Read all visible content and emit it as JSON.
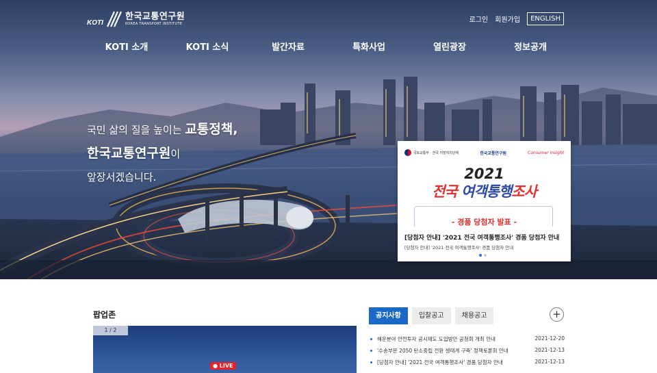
{
  "header": {
    "logo_ko": "한국교통연구원",
    "logo_en": "KOREA TRANSPORT INSTITUTE",
    "logo_mark": "KOTI",
    "util": {
      "login": "로그인",
      "signup": "회원가입",
      "english": "ENGLISH"
    }
  },
  "nav": [
    "KOTI 소개",
    "KOTI 소식",
    "발간자료",
    "특화사업",
    "열린광장",
    "정보공개"
  ],
  "slogan": {
    "line1_prefix": "국민 삶의 질을 높이는 ",
    "line1_strong": "교통정책,",
    "line2_strong": "한국교통연구원",
    "line2_suffix": "이",
    "line3": "앞장서겠습니다."
  },
  "popup_card": {
    "gov_label": "국토교통부 · 전국 지방자치단체",
    "koti_label": "한국교통연구원",
    "insight_label": "Consumer Insight",
    "year": "2021",
    "title_red": "전국 ",
    "title_blue": "여객통행",
    "title_red2": "조사",
    "prize": "- 경품 당첨자 발표 -",
    "headline": "[당첨자 안내] '2021 전국 여객통행조사' 경품 당첨자 안내",
    "sub": "[당첨자 안내] '2021 전국 여객통행조사' 경품 당첨자 안내"
  },
  "popupzone": {
    "title": "팝업존",
    "pager": "1 / 2",
    "live": "LIVE"
  },
  "tabs": [
    "공지사항",
    "입찰공고",
    "채용공고"
  ],
  "more_label": "+",
  "notices": [
    {
      "title": "해운분야 안전투자 공시제도 도입방안 공청회 개최 안내",
      "date": "2021-12-20"
    },
    {
      "title": "'수송부문 2050 탄소중립 전환 생태계 구축' 정책토론회 안내",
      "date": "2021-12-13"
    },
    {
      "title": "[당첨자 안내] '2021 전국 여객통행조사' 경품 당첨자 안내",
      "date": "2021-12-13"
    }
  ],
  "colors": {
    "accent": "#1c68c7",
    "live": "#e8202a",
    "survey_red": "#e03030",
    "survey_blue": "#2e4aa8"
  }
}
